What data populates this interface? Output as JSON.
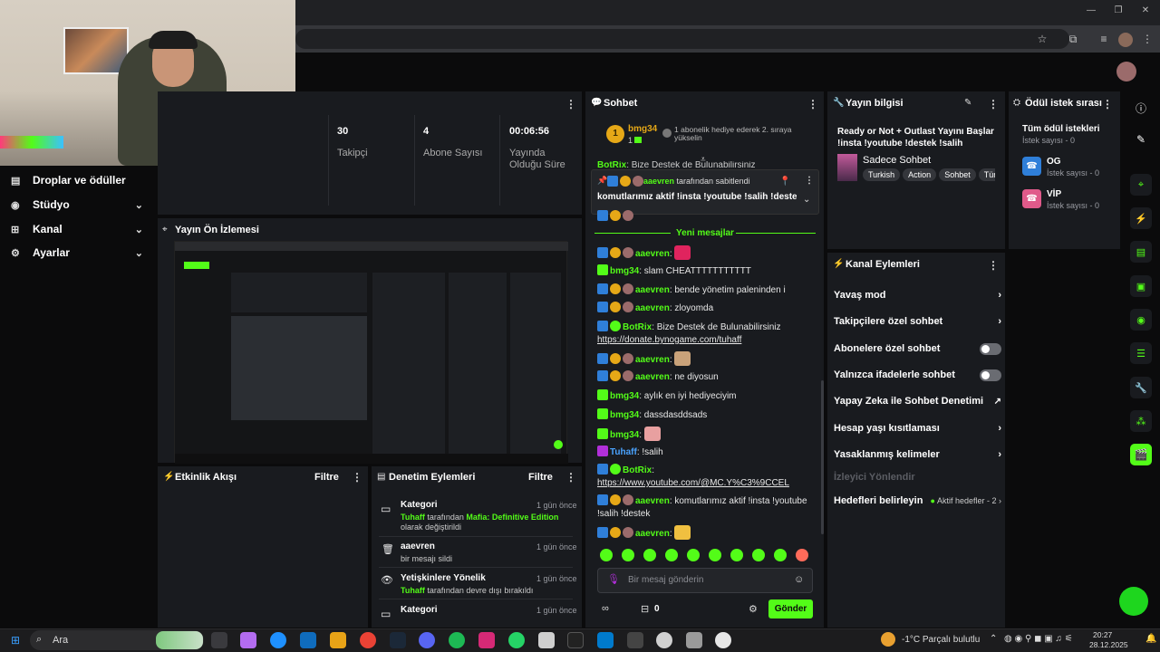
{
  "sidebar": {
    "items": [
      {
        "label": "Droplar ve ödüller",
        "icon": "gift-icon"
      },
      {
        "label": "Stüdyo",
        "icon": "studio-icon"
      },
      {
        "label": "Kanal",
        "icon": "channel-icon"
      },
      {
        "label": "Ayarlar",
        "icon": "gear-icon"
      }
    ]
  },
  "stats": [
    {
      "value": "30",
      "label": "Takipçi"
    },
    {
      "value": "4",
      "label": "Abone Sayısı"
    },
    {
      "value": "00:06:56",
      "label": "Yayında Olduğu Süre"
    }
  ],
  "preview": {
    "title": "Yayın Ön İzlemesi"
  },
  "activity": {
    "title": "Etkinlik Akışı",
    "filter": "Filtre"
  },
  "moderation": {
    "title": "Denetim Eylemleri",
    "filter": "Filtre",
    "items": [
      {
        "title": "Kategori",
        "time": "1 gün önce",
        "user": "Tuhaff",
        "mid": " tarafından ",
        "target": "Mafia: Definitive Edition",
        "rest": " olarak değiştirildi",
        "icon": "category-icon"
      },
      {
        "title": "aaevren",
        "time": "1 gün önce",
        "desc": "bir mesajı sildi",
        "icon": "trash-icon"
      },
      {
        "title": "Yetişkinlere Yönelik",
        "time": "1 gün önce",
        "user": "Tuhaff",
        "rest": " tarafından devre dışı bırakıldı",
        "icon": "eye-icon"
      },
      {
        "title": "Kategori",
        "time": "1 gün önce",
        "icon": "category-icon"
      }
    ]
  },
  "chat": {
    "title": "Sohbet",
    "top_gifter": {
      "name": "bmg34",
      "count": "1",
      "rank": "1",
      "note": "1 abonelik hediye ederek 2. sıraya yükselin"
    },
    "bg_line": {
      "user": "BotRix",
      "text": ": Bize Destek de Bulunabilirsiniz"
    },
    "pinned": {
      "by_user": "aaevren",
      "by_text": " tarafından sabitlendi",
      "text": "komutlarımız aktif !insta !youtube !salih !destek"
    },
    "new_messages": "Yeni mesajlar",
    "messages": [
      {
        "user": "aaevren",
        "text": ": ",
        "emote": "#e0245e"
      },
      {
        "user": "bmg34",
        "text": ": slam CHEATTTTTTTTTTT"
      },
      {
        "user": "aaevren",
        "text": ": bende yönetim paleninden i"
      },
      {
        "user": "aaevren",
        "text": ": zloyomda"
      },
      {
        "user": "BotRix",
        "text": ": Bize Destek de Bulunabilirsiniz",
        "link": "https://donate.bynogame.com/tuhaff"
      },
      {
        "user": "aaevren",
        "text": ": ",
        "emote": "#c9a27a"
      },
      {
        "user": "aaevren",
        "text": ": ne diyosun"
      },
      {
        "user": "bmg34",
        "text": ": aylık en iyi hediyeciyim"
      },
      {
        "user": "bmg34",
        "text": ": dassdasddsads"
      },
      {
        "user": "bmg34",
        "text": ": ",
        "emote": "#e8a0a0"
      },
      {
        "user": "Tuhaff",
        "text": ": !salih"
      },
      {
        "user": "BotRix",
        "text": ":",
        "link": "https://www.youtube.com/@MC.Y%C3%9CCEL"
      },
      {
        "user": "aaevren",
        "text": ": komutlarımız aktif !insta !youtube !salih !destek"
      },
      {
        "user": "aaevren",
        "text": ": ",
        "emote": "#f0c040"
      }
    ],
    "input_placeholder": "Bir mesaj gönderin",
    "points": "0",
    "send_label": "Gönder"
  },
  "stream_info": {
    "title": "Yayın bilgisi",
    "stream_title": "Ready or Not + Outlast Yayını Başlar !insta !youtube !destek !salih",
    "category": "Sadece Sohbet",
    "tags": [
      "Turkish",
      "Action",
      "Sohbet",
      "Tür"
    ]
  },
  "rewards": {
    "title": "Ödül istek sırası",
    "all_title": "Tüm ödül istekleri",
    "all_count": "İstek sayısı - 0",
    "items": [
      {
        "name": "OG",
        "count": "İstek sayısı - 0",
        "color": "#2f7fd9"
      },
      {
        "name": "VİP",
        "count": "İstek sayısı - 0",
        "color": "#e05a8a"
      }
    ]
  },
  "channel_actions": {
    "title": "Kanal Eylemleri",
    "rows": [
      {
        "label": "Yavaş mod",
        "ctrl": "chevron"
      },
      {
        "label": "Takipçilere özel sohbet",
        "ctrl": "chevron"
      },
      {
        "label": "Abonelere özel sohbet",
        "ctrl": "toggle"
      },
      {
        "label": "Yalnızca ifadelerle sohbet",
        "ctrl": "toggle"
      },
      {
        "label": "Yapay Zeka ile Sohbet Denetimi",
        "ctrl": "external"
      },
      {
        "label": "Hesap yaşı kısıtlaması",
        "ctrl": "chevron"
      },
      {
        "label": "Yasaklanmış kelimeler",
        "ctrl": "chevron"
      },
      {
        "label": "İzleyici Yönlendir",
        "ctrl": "none",
        "disabled": true
      },
      {
        "label": "Hedefleri belirleyin",
        "ctrl": "chevron",
        "extra": "Aktif hedefler - 2"
      }
    ]
  },
  "taskbar": {
    "search": "Ara",
    "weather": "-1°C  Parçalı bulutlu",
    "time": "20:27",
    "date": "28.12.2025"
  },
  "colors": {
    "accent": "#53fc18",
    "panel": "#191b1f",
    "bg": "#0b0b0c"
  }
}
